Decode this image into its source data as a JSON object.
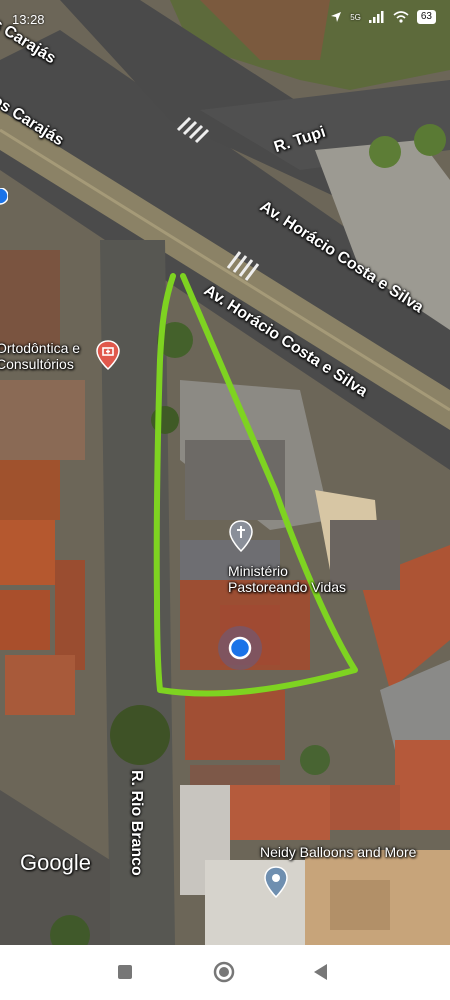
{
  "status_bar": {
    "time": "13:28",
    "network": "5G",
    "battery": "63"
  },
  "map": {
    "streets": [
      {
        "id": "carajas-top",
        "label": "os Carajás"
      },
      {
        "id": "carajas-mid",
        "label": "os Carajás"
      },
      {
        "id": "tupi",
        "label": "R. Tupi"
      },
      {
        "id": "horacio-1",
        "label": "Av. Horácio Costa e Silva"
      },
      {
        "id": "horacio-2",
        "label": "Av. Horácio Costa e Silva"
      },
      {
        "id": "rio-branco",
        "label": "R. Rio Branco"
      }
    ],
    "places": {
      "ortodontica": {
        "line1": "Ortodôntica e",
        "line2": "Consultórios",
        "icon": "medical-pin-icon"
      },
      "ministerio": {
        "line1": "Ministério",
        "line2": "Pastoreando Vidas",
        "icon": "church-pin-icon"
      },
      "neidy": {
        "line1": "Neidy Balloons and More",
        "icon": "place-pin-icon"
      }
    },
    "attribution": "Google",
    "colors": {
      "highlight": "#7ed321",
      "location_dot": "#1a73e8",
      "medical_pin": "#e0584c"
    }
  },
  "nav_bar": {
    "buttons": [
      "recent-apps",
      "home",
      "back"
    ]
  }
}
